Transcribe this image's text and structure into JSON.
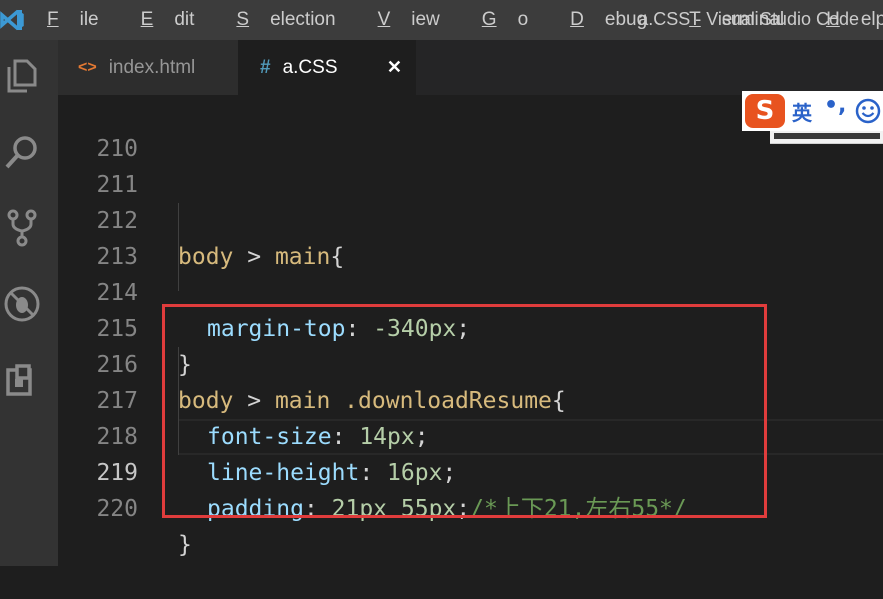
{
  "titlebar": {
    "menu": [
      {
        "first": "F",
        "rest": "ile"
      },
      {
        "first": "E",
        "rest": "dit"
      },
      {
        "first": "S",
        "rest": "election"
      },
      {
        "first": "V",
        "rest": "iew"
      },
      {
        "first": "G",
        "rest": "o"
      },
      {
        "first": "D",
        "rest": "ebug"
      },
      {
        "first": "T",
        "rest": "erminal"
      },
      {
        "first": "H",
        "rest": "elp"
      }
    ],
    "window_title": "a.CSS - Visual Studio Code"
  },
  "activitybar": {
    "icons": [
      "explorer-icon",
      "search-icon",
      "source-control-icon",
      "debug-icon",
      "extensions-icon"
    ]
  },
  "tabs": [
    {
      "icon": "<>",
      "label": "index.html",
      "active": false
    },
    {
      "icon": "#",
      "label": "a.CSS",
      "active": true,
      "close": "✕"
    }
  ],
  "editor": {
    "active_line": "219",
    "lines": [
      {
        "n": "210"
      },
      {
        "n": "211"
      },
      {
        "n": "212",
        "sel": "body",
        "p1": " > ",
        "sel2": "main",
        "p2": "{"
      },
      {
        "n": "213"
      },
      {
        "n": "214",
        "prop": "margin-top",
        "colon": ": ",
        "val": "-340px",
        "end": ";"
      },
      {
        "n": "215",
        "p1": "}"
      },
      {
        "n": "216",
        "sel": "body",
        "p1": " > ",
        "sel2": "main",
        "cls": " .downloadResume",
        "p2": "{"
      },
      {
        "n": "217",
        "prop": "font-size",
        "colon": ": ",
        "val": "14px",
        "end": ";"
      },
      {
        "n": "218",
        "prop": "line-height",
        "colon": ": ",
        "val": "16px",
        "end": ";"
      },
      {
        "n": "219",
        "prop": "padding",
        "colon": ": ",
        "val": "21px 55px",
        "end": ";",
        "cmt": "/*上下21,左右55*/"
      },
      {
        "n": "220",
        "p1": "}"
      }
    ]
  },
  "ime": {
    "logo": "S",
    "mode": "英",
    "punct": "•,"
  },
  "colors": {
    "highlight_box": "#e03c3c",
    "selector": "#d7ba7d",
    "property": "#9cdcfe",
    "number": "#b5cea8",
    "comment": "#6a9955"
  }
}
